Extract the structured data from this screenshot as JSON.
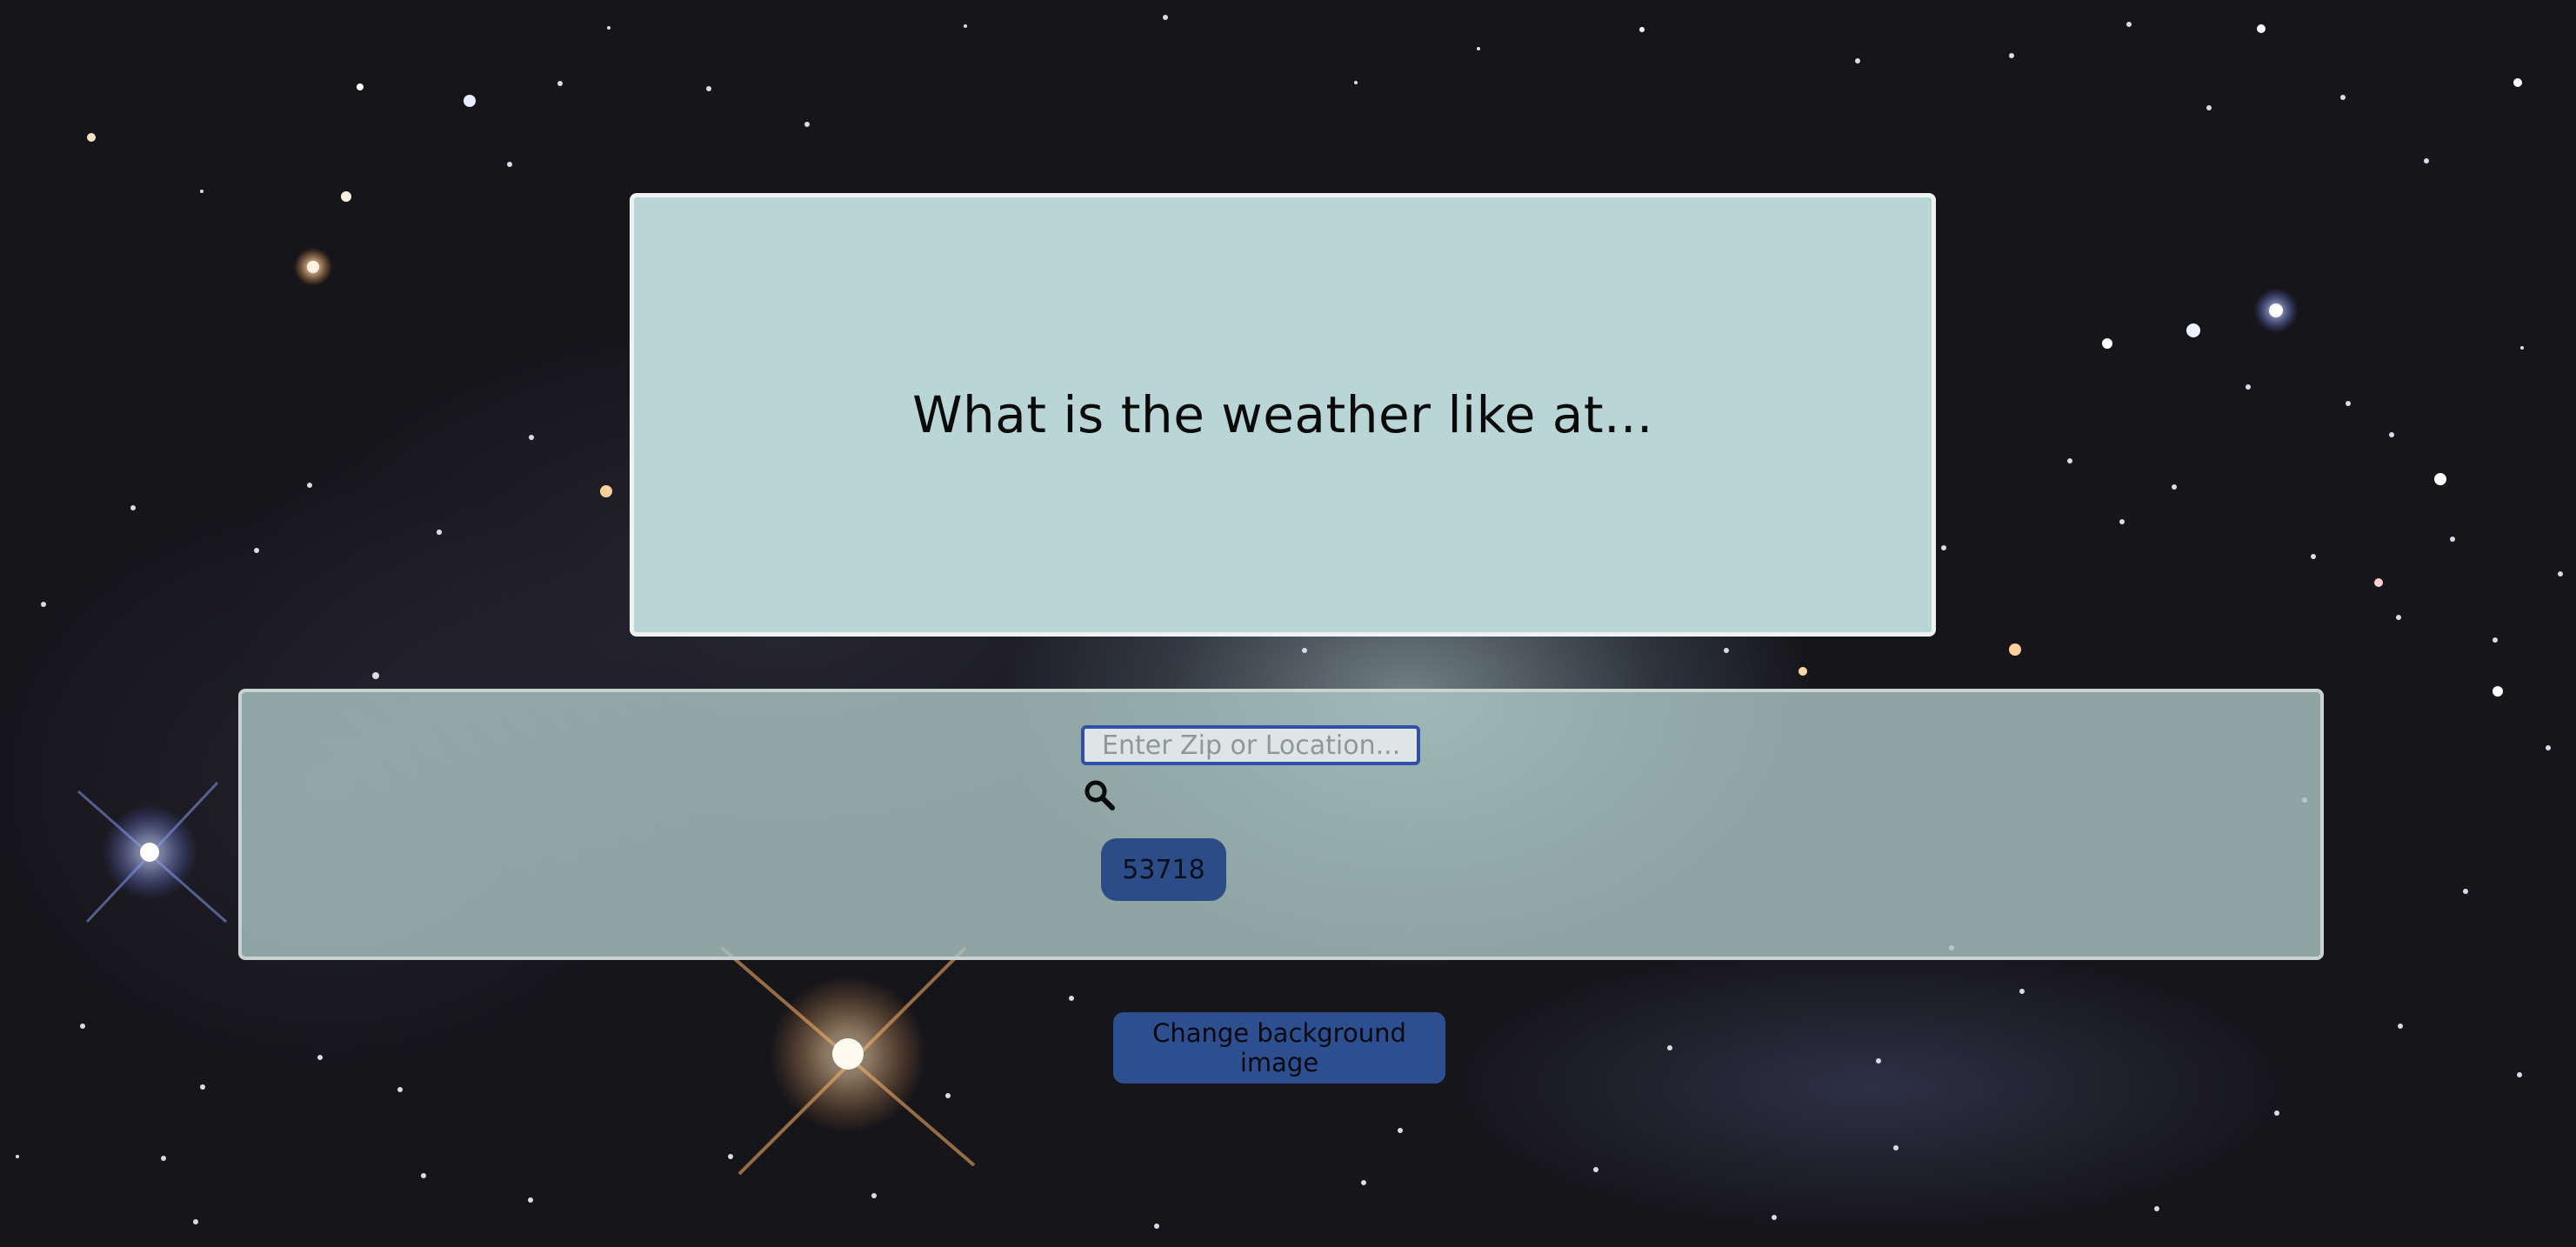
{
  "header": {
    "title": "What is the weather like at..."
  },
  "search": {
    "placeholder": "Enter Zip or Location...",
    "value": "",
    "button_icon": "search-icon"
  },
  "recent_searches": [
    {
      "label": "53718"
    }
  ],
  "footer": {
    "change_background_label": "Change background image"
  },
  "colors": {
    "title_card_bg": "#bad5d6",
    "panel_bg": "#aac4c2",
    "button_bg": "#2c4c88",
    "input_border": "#2f4fa8"
  }
}
